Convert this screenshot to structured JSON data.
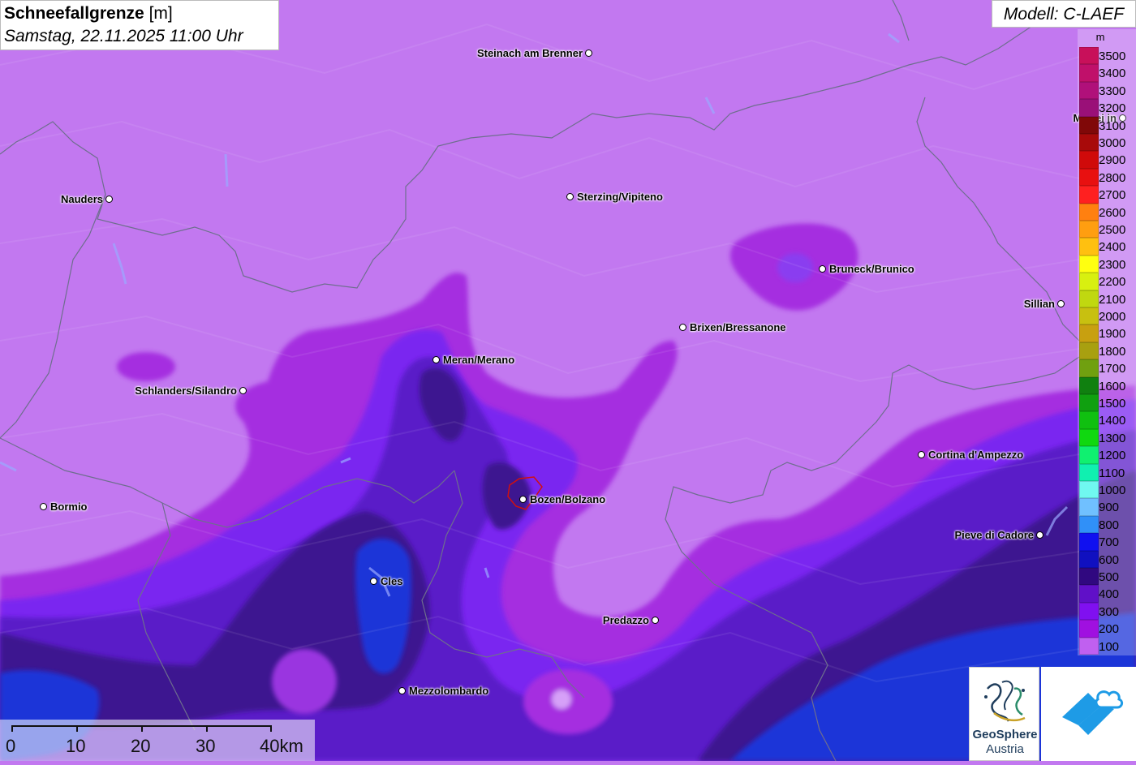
{
  "title": {
    "parameter": "Schneefallgrenze",
    "unit": "[m]",
    "datetime": "Samstag, 22.11.2025 11:00 Uhr"
  },
  "model": "Modell: C-LAEF",
  "legend": {
    "unit": "m",
    "entries": [
      {
        "label": "3500",
        "color": "#c8105a"
      },
      {
        "label": "3400",
        "color": "#c0106a"
      },
      {
        "label": "3300",
        "color": "#b0107a"
      },
      {
        "label": "3200",
        "color": "#9a1078"
      },
      {
        "label": "3100",
        "color": "#800808"
      },
      {
        "label": "3000",
        "color": "#a80a0a"
      },
      {
        "label": "2900",
        "color": "#d00a0a"
      },
      {
        "label": "2800",
        "color": "#e81010"
      },
      {
        "label": "2700",
        "color": "#ff2020"
      },
      {
        "label": "2600",
        "color": "#ff8010"
      },
      {
        "label": "2500",
        "color": "#ff9e10"
      },
      {
        "label": "2400",
        "color": "#ffc010"
      },
      {
        "label": "2300",
        "color": "#ffff10"
      },
      {
        "label": "2200",
        "color": "#d8f010"
      },
      {
        "label": "2100",
        "color": "#c0d810"
      },
      {
        "label": "2000",
        "color": "#c8c010"
      },
      {
        "label": "1900",
        "color": "#c8a010"
      },
      {
        "label": "1800",
        "color": "#a8a010"
      },
      {
        "label": "1700",
        "color": "#70a010"
      },
      {
        "label": "1600",
        "color": "#108010"
      },
      {
        "label": "1500",
        "color": "#10a010"
      },
      {
        "label": "1400",
        "color": "#10c010"
      },
      {
        "label": "1300",
        "color": "#10d810"
      },
      {
        "label": "1200",
        "color": "#10f070"
      },
      {
        "label": "1100",
        "color": "#10f0b0"
      },
      {
        "label": "1000",
        "color": "#70f8f0"
      },
      {
        "label": "900",
        "color": "#70c0ff"
      },
      {
        "label": "800",
        "color": "#3090f8"
      },
      {
        "label": "700",
        "color": "#1010f0"
      },
      {
        "label": "600",
        "color": "#1010c0"
      },
      {
        "label": "500",
        "color": "#300880"
      },
      {
        "label": "400",
        "color": "#6010c8"
      },
      {
        "label": "300",
        "color": "#8010f0"
      },
      {
        "label": "200",
        "color": "#a010e0"
      },
      {
        "label": "100",
        "color": "#c060f0"
      }
    ]
  },
  "places": [
    {
      "name": "Steinach am Brenner",
      "label_pos": "left"
    },
    {
      "name": "Nauders",
      "label_pos": "left"
    },
    {
      "name": "Sterzing/Vipiteno",
      "label_pos": "right"
    },
    {
      "name": "Matrei in",
      "label_pos": "left"
    },
    {
      "name": "Bruneck/Brunico",
      "label_pos": "right"
    },
    {
      "name": "Sillian",
      "label_pos": "left"
    },
    {
      "name": "Brixen/Bressanone",
      "label_pos": "right"
    },
    {
      "name": "Meran/Merano",
      "label_pos": "right"
    },
    {
      "name": "Schlanders/Silandro",
      "label_pos": "left"
    },
    {
      "name": "Cortina d'Ampezzo",
      "label_pos": "right"
    },
    {
      "name": "Bozen/Bolzano",
      "label_pos": "right"
    },
    {
      "name": "Bormio",
      "label_pos": "right"
    },
    {
      "name": "Pieve di Cadore",
      "label_pos": "left"
    },
    {
      "name": "Cles",
      "label_pos": "right"
    },
    {
      "name": "Predazzo",
      "label_pos": "left"
    },
    {
      "name": "Mezzolombardo",
      "label_pos": "right"
    }
  ],
  "scalebar": {
    "labels": [
      "0",
      "10",
      "20",
      "30",
      "40km"
    ]
  },
  "logo": {
    "line1": "GeoSphere",
    "line2": "Austria"
  }
}
